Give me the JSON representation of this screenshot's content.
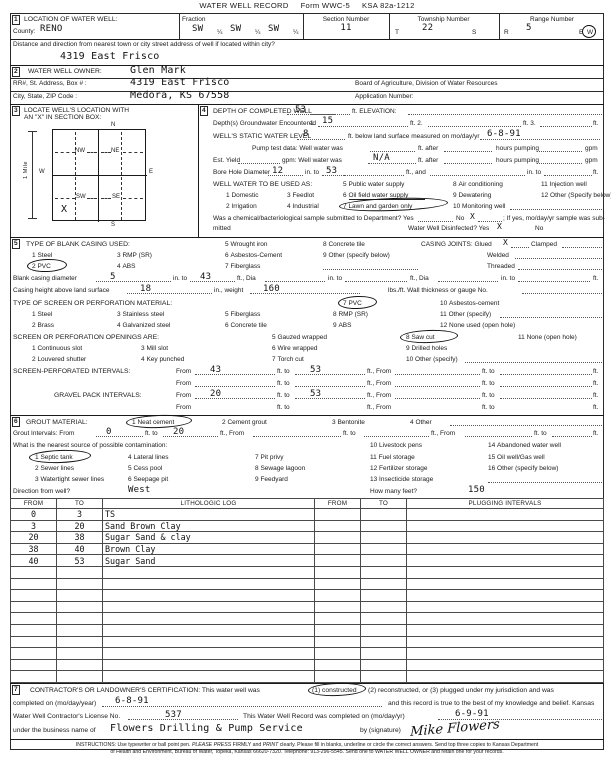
{
  "document": {
    "title": "WATER WELL RECORD",
    "form_no": "Form WWC-5",
    "statute": "KSA 82a-1212"
  },
  "section1": {
    "number": "1",
    "heading": "LOCATION OF WATER WELL:",
    "county_label": "County:",
    "county_value": "RENO",
    "fraction_label": "Fraction",
    "fraction_1": "SW",
    "fraction_2": "SW",
    "fraction_3": "SW",
    "quarter_mark": "¼",
    "section_label": "Section Number",
    "section_value": "11",
    "township_label": "Township Number",
    "township_prefix": "T",
    "township_value": "22",
    "township_suffix": "S",
    "range_label": "Range Number",
    "range_prefix": "R",
    "range_value": "5",
    "range_east": "E",
    "range_west": "W",
    "range_circled": "W",
    "distance_question": "Distance and direction from nearest town or city street address of well if located within city?",
    "distance_value": "4319 East Frisco"
  },
  "section2": {
    "number": "2",
    "heading": "WATER WELL OWNER:",
    "owner_value": "Glen Mark",
    "address_label": "RR#, St. Address, Box # :",
    "address_value": "4319 East Frisco",
    "city_label": "City, State, ZIP Code           :",
    "city_value": "Medora, KS  67558",
    "agency_line": "Board of Agriculture, Division of Water Resources",
    "application_label": "Application Number:",
    "application_value": ""
  },
  "section3": {
    "number": "3",
    "heading_line1": "LOCATE WELL'S LOCATION WITH",
    "heading_line2": "AN \"X\" IN SECTION BOX:",
    "north": "N",
    "south": "S",
    "east": "E",
    "west": "W",
    "mile_label": "1 Mile",
    "quad_nw": "NW",
    "quad_ne": "NE",
    "quad_sw": "SW",
    "quad_se": "SE",
    "mark": "X",
    "mark_quadrant": "SW"
  },
  "section4": {
    "number": "4",
    "depth_label": "DEPTH OF COMPLETED WELL",
    "depth_value": "53",
    "depth_unit": "ft. ELEVATION:",
    "elevation_value": "",
    "gw_label": "Depth(s) Groundwater Encountered",
    "gw_1_num": "1.",
    "gw_1_value": "15",
    "gw_unit1": "ft. 2.",
    "gw_2_value": "",
    "gw_unit2": "ft. 3.",
    "gw_3_value": "",
    "gw_unit3": "ft.",
    "static_label": "WELL'S STATIC WATER LEVEL",
    "static_value": "8",
    "static_unit": "ft. below land surface measured on mo/day/yr",
    "static_date": "6-8-91",
    "pump_test_label": "Pump test data:   Well water was",
    "pump_test_value": "",
    "pump_ft_after": "ft. after",
    "pump_hours": "hours pumping",
    "pump_gpm": "gpm",
    "yield_label": "Est. Yield",
    "yield_value": "",
    "yield_unit": "gpm:  Well water was",
    "yield_water_value": "N/A",
    "bore_label": "Bore Hole Diameter",
    "bore_diameter": "12",
    "bore_in_to": "in. to",
    "bore_depth": "53",
    "bore_ft_and": "ft., and",
    "bore_diameter2": "",
    "bore_in_to2": "in. to",
    "bore_depth2": "",
    "bore_ft2": "ft.",
    "use_label": "WELL WATER TO BE USED AS:",
    "use_options": [
      {
        "num": "1",
        "text": "Domestic",
        "marked": "none"
      },
      {
        "num": "2",
        "text": "Irrigation",
        "marked": "none"
      },
      {
        "num": "3",
        "text": "Feedlot",
        "marked": "none"
      },
      {
        "num": "4",
        "text": "Industrial",
        "marked": "none"
      },
      {
        "num": "5",
        "text": "Public water supply",
        "marked": "none"
      },
      {
        "num": "6",
        "text": "Oil field water supply",
        "marked": "strike"
      },
      {
        "num": "7",
        "text": "Lawn and garden only",
        "marked": "circle"
      },
      {
        "num": "8",
        "text": "Air conditioning",
        "marked": "none"
      },
      {
        "num": "9",
        "text": "Dewatering",
        "marked": "none"
      },
      {
        "num": "10",
        "text": "Monitoring well",
        "marked": "none"
      },
      {
        "num": "11",
        "text": "Injection well",
        "marked": "none"
      },
      {
        "num": "12",
        "text": "Other (Specify below)",
        "marked": "none"
      }
    ],
    "sample_question": "Was a chemical/bacteriological sample submitted to Department? Yes",
    "sample_no_label": "No",
    "sample_no_mark": "X",
    "sample_tail": "; If yes, mo/day/yr sample was sub-",
    "sample_tail2": "mitted",
    "disinfected_label": "Water Well Disinfected?  Yes",
    "disinfected_yes_mark": "X",
    "disinfected_no_label": "No"
  },
  "section5": {
    "number": "5",
    "casing_heading": "TYPE OF BLANK CASING USED:",
    "casing_options": [
      {
        "num": "1",
        "text": "Steel",
        "marked": "none"
      },
      {
        "num": "2",
        "text": "PVC",
        "marked": "circle"
      },
      {
        "num": "3",
        "text": "RMP (SR)",
        "marked": "none"
      },
      {
        "num": "4",
        "text": "ABS",
        "marked": "none"
      },
      {
        "num": "5",
        "text": "Wrought iron",
        "marked": "none"
      },
      {
        "num": "6",
        "text": "Asbestos-Cement",
        "marked": "none"
      },
      {
        "num": "7",
        "text": "Fiberglass",
        "marked": "none"
      },
      {
        "num": "8",
        "text": "Concrete tile",
        "marked": "none"
      },
      {
        "num": "9",
        "text": "Other (specify below)",
        "marked": "none"
      }
    ],
    "joints_label": "CASING JOINTS: Glued",
    "joints_glued_mark": "X",
    "joints_clamped": "Clamped",
    "joints_welded": "Welded",
    "joints_threaded": "Threaded",
    "blank_dia_label": "Blank casing diameter",
    "blank_dia_value": "5",
    "blank_dia_unit": "in. to",
    "blank_dia_depth": "43",
    "blank_ft_dia": "ft., Dia",
    "blank_dia2": "",
    "blank_in_to2": "in. to",
    "blank_depth2": "",
    "blank_ft_dia2": "ft., Dia",
    "blank_dia3": "",
    "blank_in_to3": "in. to",
    "blank_depth3": "",
    "blank_ft3": "ft.",
    "height_label": "Casing height above land surface",
    "height_value": "18",
    "height_unit": "in., weight",
    "weight_value": "160",
    "weight_unit": "lbs./ft. Wall thickness or gauge No.",
    "wall_value": "",
    "screen_mat_heading": "TYPE OF SCREEN OR PERFORATION MATERIAL:",
    "screen_mat_options": [
      {
        "num": "1",
        "text": "Steel",
        "marked": "none"
      },
      {
        "num": "2",
        "text": "Brass",
        "marked": "none"
      },
      {
        "num": "3",
        "text": "Stainless steel",
        "marked": "none"
      },
      {
        "num": "4",
        "text": "Galvanized steel",
        "marked": "none"
      },
      {
        "num": "5",
        "text": "Fiberglass",
        "marked": "none"
      },
      {
        "num": "6",
        "text": "Concrete tile",
        "marked": "none"
      },
      {
        "num": "7",
        "text": "PVC",
        "marked": "circle"
      },
      {
        "num": "8",
        "text": "RMP (SR)",
        "marked": "none"
      },
      {
        "num": "9",
        "text": "ABS",
        "marked": "none"
      },
      {
        "num": "10",
        "text": "Asbestos-cement",
        "marked": "none"
      },
      {
        "num": "11",
        "text": "Other (specify)",
        "marked": "none"
      },
      {
        "num": "12",
        "text": "None used (open hole)",
        "marked": "none"
      }
    ],
    "openings_heading": "SCREEN OR PERFORATION OPENINGS ARE:",
    "openings_options": [
      {
        "num": "1",
        "text": "Continuous slot",
        "marked": "none"
      },
      {
        "num": "2",
        "text": "Louvered shutter",
        "marked": "none"
      },
      {
        "num": "3",
        "text": "Mill slot",
        "marked": "none"
      },
      {
        "num": "4",
        "text": "Key punched",
        "marked": "none"
      },
      {
        "num": "5",
        "text": "Gauzed wrapped",
        "marked": "none"
      },
      {
        "num": "6",
        "text": "Wire wrapped",
        "marked": "none"
      },
      {
        "num": "7",
        "text": "Torch cut",
        "marked": "none"
      },
      {
        "num": "8",
        "text": "Saw cut",
        "marked": "circle"
      },
      {
        "num": "9",
        "text": "Drilled holes",
        "marked": "none"
      },
      {
        "num": "10",
        "text": "Other (specify)",
        "marked": "none"
      },
      {
        "num": "11",
        "text": "None (open hole)",
        "marked": "none"
      }
    ],
    "screen_int_label": "SCREEN-PERFORATED INTERVALS:",
    "gravel_int_label": "GRAVEL PACK INTERVALS:",
    "from_label": "From",
    "to_label": "ft. to",
    "ft_from_label": "ft., From",
    "ft_to_label": "ft. to",
    "ft_label": "ft.",
    "screen_intervals": [
      {
        "from": "43",
        "to": "53",
        "from2": "",
        "to2": ""
      },
      {
        "from": "",
        "to": "",
        "from2": "",
        "to2": ""
      }
    ],
    "gravel_intervals": [
      {
        "from": "20",
        "to": "53",
        "from2": "",
        "to2": ""
      },
      {
        "from": "",
        "to": "",
        "from2": "",
        "to2": ""
      }
    ]
  },
  "section6": {
    "number": "6",
    "grout_heading": "GROUT MATERIAL:",
    "grout_options": [
      {
        "num": "1",
        "text": "Neat cement",
        "marked": "circle"
      },
      {
        "num": "2",
        "text": "Cement grout",
        "marked": "none"
      },
      {
        "num": "3",
        "text": "Bentonite",
        "marked": "none"
      },
      {
        "num": "4",
        "text": "Other",
        "marked": "none"
      }
    ],
    "grout_int_label": "Grout Intervals:     From",
    "grout_from": "0",
    "grout_to_label": "ft. to",
    "grout_to": "20",
    "grout_ft_from": "ft.,  From",
    "grout_from2": "",
    "grout_to_label2": "ft.  to",
    "grout_to2": "",
    "grout_ft_from2": "ft.,  From",
    "grout_from3": "",
    "grout_to_label3": "ft. to",
    "grout_to3": "",
    "grout_ft3": "ft.",
    "contam_question": "What is the nearest source of possible contamination:",
    "contam_options": [
      {
        "num": "1",
        "text": "Septic tank",
        "marked": "circle"
      },
      {
        "num": "2",
        "text": "Sewer lines",
        "marked": "none"
      },
      {
        "num": "3",
        "text": "Watertight sewer lines",
        "marked": "none"
      },
      {
        "num": "4",
        "text": "Lateral lines",
        "marked": "none"
      },
      {
        "num": "5",
        "text": "Cess pool",
        "marked": "none"
      },
      {
        "num": "6",
        "text": "Seepage pit",
        "marked": "none"
      },
      {
        "num": "7",
        "text": "Pit privy",
        "marked": "none"
      },
      {
        "num": "8",
        "text": "Sewage lagoon",
        "marked": "none"
      },
      {
        "num": "9",
        "text": "Feedyard",
        "marked": "none"
      },
      {
        "num": "10",
        "text": "Livestock pens",
        "marked": "none"
      },
      {
        "num": "11",
        "text": "Fuel storage",
        "marked": "none"
      },
      {
        "num": "12",
        "text": "Fertilizer storage",
        "marked": "none"
      },
      {
        "num": "13",
        "text": "Insecticide storage",
        "marked": "none"
      },
      {
        "num": "14",
        "text": "Abandoned water well",
        "marked": "none"
      },
      {
        "num": "15",
        "text": "Oil well/Gas well",
        "marked": "none"
      },
      {
        "num": "16",
        "text": "Other (specify below)",
        "marked": "none"
      }
    ],
    "direction_label": "Direction from well?",
    "direction_value": "West",
    "feet_label": "How many feet?",
    "feet_value": "150"
  },
  "litho_table": {
    "headers": {
      "from": "FROM",
      "to": "TO",
      "log": "LITHOLOGIC LOG",
      "p_from": "FROM",
      "p_to": "TO",
      "plugging": "PLUGGING INTERVALS"
    },
    "rows": [
      {
        "from": "0",
        "to": "3",
        "log": "TS",
        "p_from": "",
        "p_to": "",
        "plug": ""
      },
      {
        "from": "3",
        "to": "20",
        "log": "Sand Brown Clay",
        "p_from": "",
        "p_to": "",
        "plug": ""
      },
      {
        "from": "20",
        "to": "38",
        "log": "Sugar Sand & clay",
        "p_from": "",
        "p_to": "",
        "plug": ""
      },
      {
        "from": "38",
        "to": "40",
        "log": "Brown Clay",
        "p_from": "",
        "p_to": "",
        "plug": ""
      },
      {
        "from": "40",
        "to": "53",
        "log": "Sugar Sand",
        "p_from": "",
        "p_to": "",
        "plug": ""
      },
      {
        "from": "",
        "to": "",
        "log": "",
        "p_from": "",
        "p_to": "",
        "plug": ""
      },
      {
        "from": "",
        "to": "",
        "log": "",
        "p_from": "",
        "p_to": "",
        "plug": ""
      },
      {
        "from": "",
        "to": "",
        "log": "",
        "p_from": "",
        "p_to": "",
        "plug": ""
      },
      {
        "from": "",
        "to": "",
        "log": "",
        "p_from": "",
        "p_to": "",
        "plug": ""
      },
      {
        "from": "",
        "to": "",
        "log": "",
        "p_from": "",
        "p_to": "",
        "plug": ""
      },
      {
        "from": "",
        "to": "",
        "log": "",
        "p_from": "",
        "p_to": "",
        "plug": ""
      },
      {
        "from": "",
        "to": "",
        "log": "",
        "p_from": "",
        "p_to": "",
        "plug": ""
      },
      {
        "from": "",
        "to": "",
        "log": "",
        "p_from": "",
        "p_to": "",
        "plug": ""
      },
      {
        "from": "",
        "to": "",
        "log": "",
        "p_from": "",
        "p_to": "",
        "plug": ""
      },
      {
        "from": "",
        "to": "",
        "log": "",
        "p_from": "",
        "p_to": "",
        "plug": ""
      }
    ]
  },
  "section7": {
    "number": "7",
    "cert_intro": "CONTRACTOR'S OR LANDOWNER'S CERTIFICATION: This water well was",
    "opt1": "(1) constructed",
    "opt1_marked": "circle",
    "opt2": "(2) reconstructed, or (3) plugged under my jurisdiction and was",
    "completed_label": "completed on (mo/day/year)",
    "completed_value": "6-8-91",
    "cert_tail": "and this record is true to the best of my knowledge and belief. Kansas",
    "license_label": "Water Well Contractor's License No.",
    "license_value": "537",
    "record_label": "This Water Well Record was completed on (mo/day/yr)",
    "record_value": "6-9-91",
    "business_label": "under the business name of",
    "business_value": "Flowers Drilling & Pump Service",
    "signature_label": "by (signature)",
    "signature_value": "Mike Flowers"
  },
  "instructions": {
    "line1_a": "INSTRUCTIONS: Use typewriter or ball point pen. ",
    "line1_b": "PLEASE PRESS",
    "line1_c": " FIRMLY and ",
    "line1_d": "PRINT",
    "line1_e": " clearly. Please fill in blanks, underline or circle the correct answers. Send top three copies to Kansas Department",
    "line2": "of Health and Environment, Bureau of Water, Topeka, Kansas 66620-7320. Telephone: 913-296-5545. Send one to WATER WELL OWNER and retain one for your records."
  }
}
